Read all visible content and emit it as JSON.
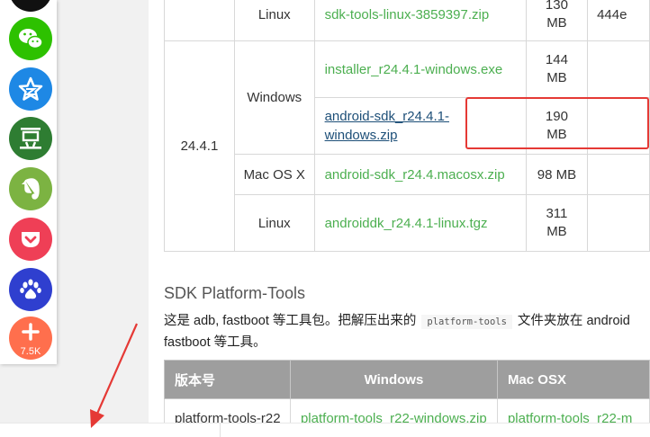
{
  "top_table": {
    "rows": [
      {
        "version": "",
        "os": "Linux",
        "file": "sdk-tools-linux-3859397.zip",
        "size": [
          "130",
          "MB"
        ],
        "hash": "444e"
      },
      {
        "version": "24.4.1",
        "os": "Windows",
        "file": "installer_r24.4.1-windows.exe",
        "size": [
          "144",
          "MB"
        ]
      },
      {
        "file_lines": [
          "android-sdk_r24.4.1-",
          "windows.zip"
        ],
        "size": [
          "190",
          "MB"
        ],
        "highlighted": true
      },
      {
        "os": "Mac OS X",
        "file": "android-sdk_r24.4.macosx.zip",
        "size": [
          "98 MB"
        ]
      },
      {
        "os": "Linux",
        "file": "androiddk_r24.4.1-linux.tgz",
        "size": [
          "311",
          "MB"
        ]
      }
    ]
  },
  "section": {
    "title": "SDK Platform-Tools",
    "desc_before": "这是 adb, fastboot 等工具包。把解压出来的",
    "code": "platform-tools",
    "desc_after": "文件夹放在 android",
    "desc_line2": "fastboot 等工具。"
  },
  "pt_table": {
    "headers": [
      "版本号",
      "Windows",
      "Mac OSX"
    ],
    "row": [
      "platform-tools-r22",
      "platform-tools_r22-windows.zip",
      "platform-tools_r22-m"
    ]
  },
  "share": {
    "count": "7.5K",
    "colors": [
      "#111111",
      "#2dc100",
      "#1e88e5",
      "#2e7d32",
      "#7cb342",
      "#ef3f56",
      "#2f3fcf",
      "#ff6f4d"
    ],
    "icons": [
      "github-icon",
      "wechat-icon",
      "qzone-star-icon",
      "douban-icon",
      "evernote-icon",
      "pocket-icon",
      "baidu-paw-icon",
      "plus-icon"
    ]
  },
  "accent": {
    "link": "#4caf50",
    "highlight": "#e53935"
  }
}
